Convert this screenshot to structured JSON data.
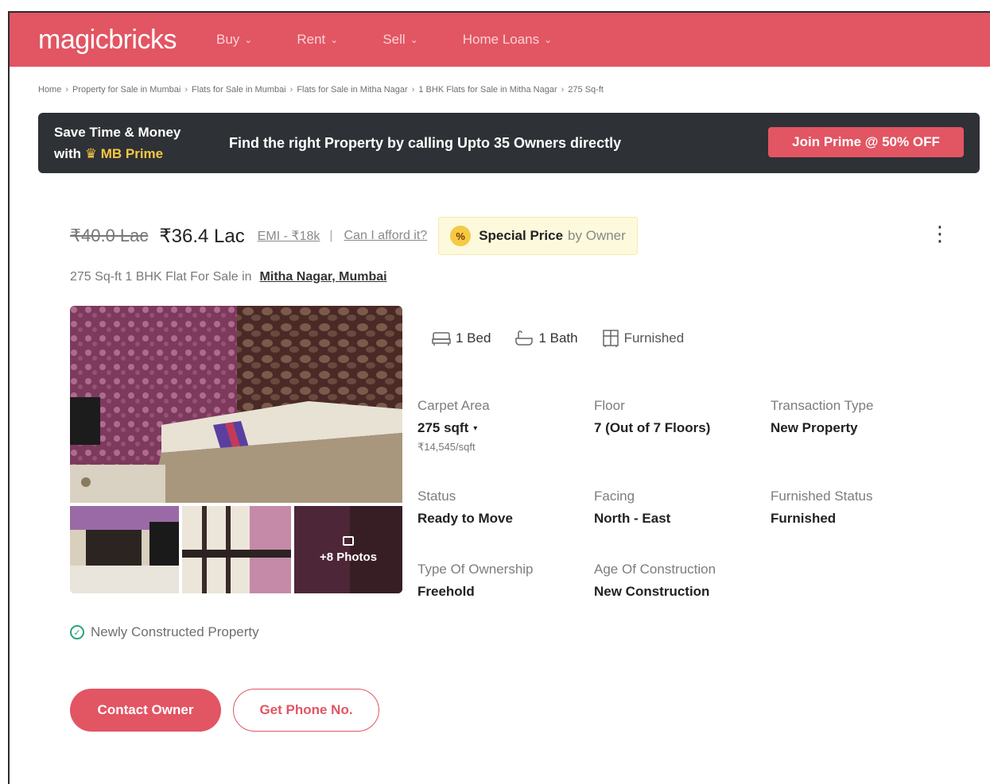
{
  "header": {
    "logo": "magicbricks",
    "nav": [
      {
        "label": "Buy"
      },
      {
        "label": "Rent"
      },
      {
        "label": "Sell"
      },
      {
        "label": "Home Loans"
      }
    ]
  },
  "breadcrumb": [
    "Home",
    "Property for Sale in Mumbai",
    "Flats for Sale in Mumbai",
    "Flats for Sale in Mitha Nagar",
    "1 BHK Flats for Sale in Mitha Nagar",
    "275 Sq-ft"
  ],
  "prime": {
    "line1": "Save Time & Money",
    "line2_prefix": "with",
    "brand": "MB Prime",
    "message": "Find the right Property by calling Upto 35 Owners directly",
    "cta": "Join Prime @ 50% OFF"
  },
  "price": {
    "old": "₹40.0 Lac",
    "current": "₹36.4 Lac",
    "emi": "EMI - ₹18k",
    "afford": "Can I afford it?",
    "special_badge": "%",
    "special_strong": "Special Price",
    "special_light": "by Owner"
  },
  "subtitle": {
    "text": "275 Sq-ft 1 BHK Flat For Sale in",
    "location": "Mitha Nagar, Mumbai"
  },
  "gallery": {
    "more_photos": "+8 Photos"
  },
  "amenities": [
    {
      "label": "1 Bed"
    },
    {
      "label": "1 Bath"
    },
    {
      "label": "Furnished"
    }
  ],
  "details": {
    "carpet_area": {
      "label": "Carpet Area",
      "value": "275 sqft",
      "sub": "₹14,545/sqft"
    },
    "floor": {
      "label": "Floor",
      "value": "7 (Out of 7 Floors)"
    },
    "transaction": {
      "label": "Transaction Type",
      "value": "New Property"
    },
    "status": {
      "label": "Status",
      "value": "Ready to Move"
    },
    "facing": {
      "label": "Facing",
      "value": "North - East"
    },
    "furnished": {
      "label": "Furnished Status",
      "value": "Furnished"
    },
    "ownership": {
      "label": "Type Of Ownership",
      "value": "Freehold"
    },
    "age": {
      "label": "Age Of Construction",
      "value": "New Construction"
    }
  },
  "newly": "Newly Constructed Property",
  "buttons": {
    "contact": "Contact Owner",
    "phone": "Get Phone No."
  },
  "colors": {
    "brand": "#e25563",
    "prime_bg": "#2e3135",
    "prime_gold": "#f7c744",
    "check_green": "#2aa37a"
  }
}
